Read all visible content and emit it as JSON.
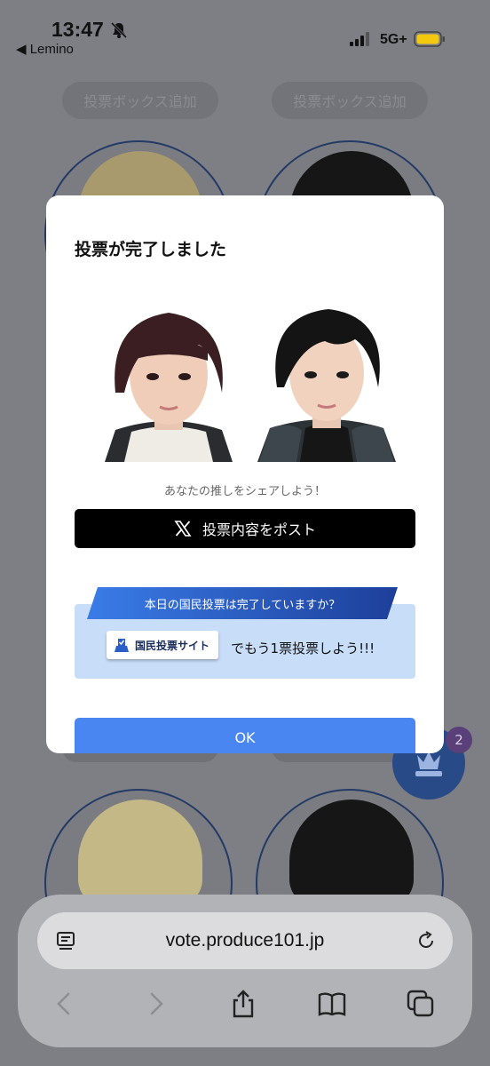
{
  "status_bar": {
    "time": "13:47",
    "back_app": "◀ Lemino",
    "network": "5G+"
  },
  "background": {
    "add_box_label": "投票ボックス追加",
    "ranking_badge": "2"
  },
  "modal": {
    "title": "投票が完了しました",
    "share_prompt": "あなたの推しをシェアしよう！",
    "post_button": "投票内容をポスト",
    "promo_banner": "本日の国民投票は完了していますか？",
    "site_chip": "国民投票サイト",
    "promo_text": "でもう1票投票しよう!!!",
    "ok_button": "OK"
  },
  "browser": {
    "url": "vote.produce101.jp"
  },
  "colors": {
    "accent_blue": "#4a86f2",
    "banner_blue": "#2b5fc8",
    "promo_bg": "#c8def8"
  }
}
